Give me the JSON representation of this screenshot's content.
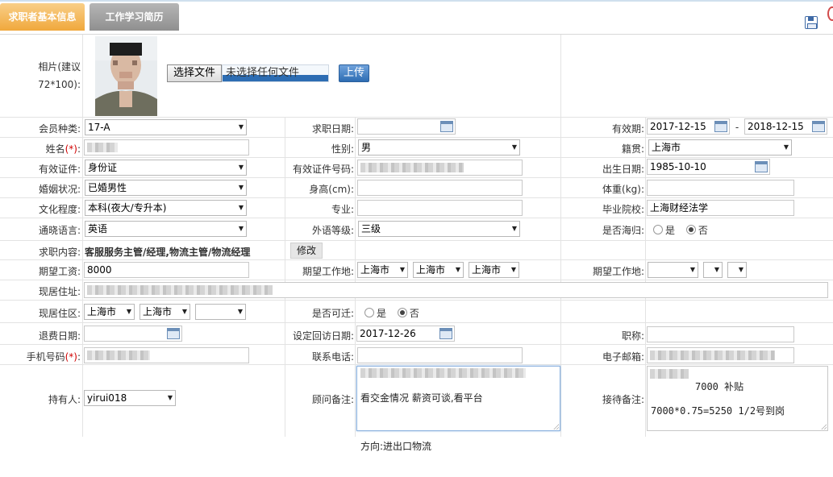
{
  "tabs": [
    "求职者基本信息",
    "工作学习简历"
  ],
  "photo": {
    "label": "相片(建议",
    "hint": "72*100):",
    "choose_btn": "选择文件",
    "no_file": "未选择任何文件",
    "upload_btn": "上传"
  },
  "member_type": {
    "label": "会员种类:",
    "value": "17-A"
  },
  "apply_date": {
    "label": "求职日期:",
    "value": ""
  },
  "validity": {
    "label": "有效期:",
    "from": "2017-12-15",
    "sep": "-",
    "to": "2018-12-15"
  },
  "name": {
    "label": "姓名",
    "req": "(*)",
    "colon": ":"
  },
  "gender": {
    "label": "性别:",
    "value": "男"
  },
  "native": {
    "label": "籍贯:",
    "value": "上海市"
  },
  "id_type": {
    "label": "有效证件:",
    "value": "身份证"
  },
  "id_no": {
    "label": "有效证件号码:"
  },
  "birth": {
    "label": "出生日期:",
    "value": "1985-10-10"
  },
  "marital": {
    "label": "婚姻状况:",
    "value": "已婚男性"
  },
  "height": {
    "label": "身高(cm):",
    "value": ""
  },
  "weight": {
    "label": "体重(kg):",
    "value": ""
  },
  "education": {
    "label": "文化程度:",
    "value": "本科(夜大/专升本)"
  },
  "major": {
    "label": "专业:",
    "value": ""
  },
  "school": {
    "label": "毕业院校:",
    "value": "上海财经法学"
  },
  "language": {
    "label": "通晓语言:",
    "value": "英语"
  },
  "lang_level": {
    "label": "外语等级:",
    "value": "三级"
  },
  "overseas": {
    "label": "是否海归:",
    "yes": "是",
    "no": "否",
    "selected": "否"
  },
  "job_content": {
    "label": "求职内容:",
    "value": "客服服务主管/经理,物流主管/物流经理",
    "edit_btn": "修改"
  },
  "salary": {
    "label": "期望工资:",
    "value": "8000"
  },
  "workplace1": {
    "label": "期望工作地:",
    "values": [
      "上海市",
      "上海市",
      "上海市"
    ]
  },
  "workplace2": {
    "label": "期望工作地:",
    "values": [
      "",
      "",
      ""
    ]
  },
  "address": {
    "label": "现居住址:"
  },
  "district": {
    "label": "现居住区:",
    "values": [
      "上海市",
      "上海市",
      ""
    ]
  },
  "relocate": {
    "label": "是否可迁:",
    "yes": "是",
    "no": "否",
    "selected": "否"
  },
  "refund_date": {
    "label": "退费日期:",
    "value": ""
  },
  "revisit_date": {
    "label": "设定回访日期:",
    "value": "2017-12-26"
  },
  "title": {
    "label": "职称:",
    "value": ""
  },
  "mobile": {
    "label": "手机号码",
    "req": "(*)",
    "colon": ":"
  },
  "phone": {
    "label": "联系电话:",
    "value": ""
  },
  "email": {
    "label": "电子邮箱:"
  },
  "owner": {
    "label": "持有人:",
    "value": "yirui018"
  },
  "consultant_note": {
    "label": "顾问备注:",
    "lines": [
      "看交金情况  薪资可谈,看平台",
      "",
      "方向:进出口物流"
    ]
  },
  "reception_note": {
    "label": "接待备注:",
    "lines": [
      "7000 补贴",
      "7000*0.75=5250  1/2号到岗"
    ]
  },
  "colors": {
    "tab_active": "#f0a83c",
    "tab_inactive": "#8f8f8f",
    "required": "#d00000",
    "upload_btn": "#2d6db3"
  }
}
